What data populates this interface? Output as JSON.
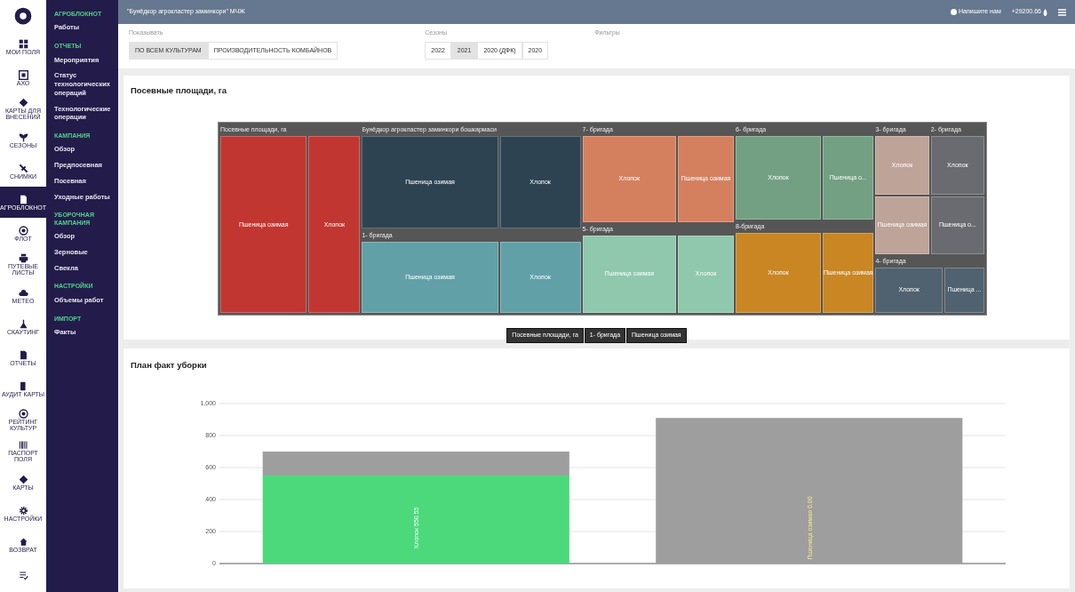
{
  "rail": [
    {
      "kind": "logo",
      "selected": false
    },
    {
      "kind": "grid",
      "label": "МОИ ПОЛЯ",
      "selected": false
    },
    {
      "kind": "qr",
      "label": "АХО",
      "selected": false
    },
    {
      "kind": "diamond",
      "label": "КАРТЫ ДЛЯ ВНЕСЕНИЙ",
      "selected": false
    },
    {
      "kind": "plant",
      "label": "СЕЗОНЫ",
      "selected": false
    },
    {
      "kind": "satellite",
      "label": "СНИМКИ",
      "selected": false
    },
    {
      "kind": "doc",
      "label": "АГРОБЛОКНОТ",
      "selected": true
    },
    {
      "kind": "wheel",
      "label": "ФЛОТ",
      "selected": false
    },
    {
      "kind": "printer",
      "label": "ПУТЕВЫЕ ЛИСТЫ",
      "selected": false
    },
    {
      "kind": "cloud",
      "label": "МЕТЕО",
      "selected": false
    },
    {
      "kind": "flask",
      "label": "СКАУТИНГ",
      "selected": false
    },
    {
      "kind": "doc",
      "label": "ОТЧЕТЫ",
      "selected": false
    },
    {
      "kind": "phone",
      "label": "АУДИТ КАРТЫ",
      "selected": false
    },
    {
      "kind": "wheel",
      "label": "РЕЙТИНГ КУЛЬТУР",
      "selected": false
    },
    {
      "kind": "barcode",
      "label": "ПАСПОРТ ПОЛЯ",
      "selected": false
    },
    {
      "kind": "diamond",
      "label": "КАРТЫ",
      "selected": false
    },
    {
      "kind": "gear",
      "label": "НАСТРОЙКИ",
      "selected": false
    },
    {
      "kind": "home",
      "label": "ВОЗВРАТ",
      "selected": false
    },
    {
      "kind": "list",
      "selected": false
    }
  ],
  "nav": [
    {
      "kind": "header",
      "label": "АГРОБЛОКНОТ"
    },
    {
      "kind": "item",
      "label": "Работы"
    },
    {
      "kind": "header",
      "label": "ОТЧЕТЫ"
    },
    {
      "kind": "item",
      "label": "Мероприятия"
    },
    {
      "kind": "item",
      "label": "Статус технологических операций"
    },
    {
      "kind": "item",
      "label": "Технологические операции"
    },
    {
      "kind": "header",
      "label": "КАМПАНИЯ"
    },
    {
      "kind": "item",
      "label": "Обзор"
    },
    {
      "kind": "item",
      "label": "Предпосевная"
    },
    {
      "kind": "item",
      "label": "Посевная"
    },
    {
      "kind": "item",
      "label": "Уходные работы"
    },
    {
      "kind": "header",
      "label": "УБОРОЧНАЯ КАМПАНИЯ"
    },
    {
      "kind": "item",
      "label": "Обзор"
    },
    {
      "kind": "item",
      "label": "Зерновые"
    },
    {
      "kind": "item",
      "label": "Свекла"
    },
    {
      "kind": "header",
      "label": "НАСТРОЙКИ"
    },
    {
      "kind": "item",
      "label": "Объемы работ"
    },
    {
      "kind": "header",
      "label": "ИМПОРТ"
    },
    {
      "kind": "item",
      "label": "Факты"
    }
  ],
  "topbar": {
    "title": "\"Бунёдкор агрокластер заминкори\" МЧЖ",
    "contact": "Напишите нам",
    "balance": "+29200.66"
  },
  "filters": {
    "show_label": "Показывать",
    "show_options": [
      {
        "label": "ПО ВСЕМ КУЛЬТУРАМ",
        "selected": true
      },
      {
        "label": "ПРОИЗВОДИТЕЛЬНОСТЬ КОМБАЙНОВ",
        "selected": false
      }
    ],
    "seasons_label": "Сезоны",
    "seasons": [
      {
        "label": "2022",
        "selected": false
      },
      {
        "label": "2021",
        "selected": true
      },
      {
        "label": "2020 (ДФК)",
        "selected": false
      },
      {
        "label": "2020",
        "selected": false
      }
    ],
    "filters_label": "Фильтры"
  },
  "treemap_card": {
    "title": "Посевные площади, га",
    "columns": [
      {
        "blocks": [
          {
            "groups": [
              {
                "name": "Посевные площади, га",
                "color": "#c13631",
                "leaves": [
                  "Пшеница озимая",
                  "Хлопок"
                ]
              }
            ]
          }
        ]
      },
      {
        "blocks": [
          {
            "groups": [
              {
                "name": "Бунёдкор агрокластер заминкори бошкармаси",
                "color": "#2e4352",
                "leaves": [
                  "Пшеница озимая",
                  "Хлопок"
                ]
              }
            ]
          },
          {
            "groups": [
              {
                "name": "1- бригада",
                "color": "#62a0a8",
                "leaves": [
                  "Пшеница озимая",
                  "Хлопок"
                ]
              }
            ]
          }
        ]
      },
      {
        "blocks": [
          {
            "groups": [
              {
                "name": "7- бригада",
                "color": "#d4805f",
                "leaves": [
                  "Хлопок",
                  "Пшеница озимая"
                ]
              }
            ]
          },
          {
            "groups": [
              {
                "name": "5- бригада",
                "color": "#8fc8ad",
                "leaves": [
                  "Пшеница озимая",
                  "Хлопок"
                ]
              }
            ]
          }
        ]
      },
      {
        "blocks": [
          {
            "groups": [
              {
                "name": "6- бригада",
                "color": "#73a083",
                "leaves": [
                  "Хлопок",
                  "Пшеница о..."
                ]
              }
            ]
          },
          {
            "groups": [
              {
                "name": "8-бригада",
                "color": "#c98623",
                "leaves": [
                  "Хлопок",
                  "Пшеница озимая"
                ]
              }
            ]
          }
        ]
      },
      {
        "blocks": [
          {
            "groups": [
              {
                "name": "3- бригада",
                "color": "#bea399",
                "leaves": [
                  "Хлопок",
                  "Пшеница озимая"
                ]
              },
              {
                "name": "2- бригада",
                "color": "#6a6b70",
                "leaves": [
                  "Хлопок",
                  "Пшеница о..."
                ]
              }
            ]
          },
          {
            "groups": [
              {
                "name": "4- бригада",
                "color": "#506270",
                "leaves": [
                  "Хлопок",
                  "Пшеница ..."
                ]
              }
            ]
          }
        ]
      }
    ],
    "breadcrumb": [
      "Посевные площади, га",
      "1- бригада",
      "Пшеница озимая"
    ]
  },
  "chart_card": {
    "title": "План факт уборки",
    "chart_data": {
      "type": "bar",
      "stacked": true,
      "orientation": "vertical",
      "grid": true,
      "ylim": [
        0,
        1000
      ],
      "yticks": [
        {
          "value": 0,
          "label": "0"
        },
        {
          "value": 200,
          "label": "200"
        },
        {
          "value": 400,
          "label": "400"
        },
        {
          "value": 600,
          "label": "600"
        },
        {
          "value": 800,
          "label": "800"
        },
        {
          "value": 1000,
          "label": "1,000"
        }
      ],
      "series": [
        {
          "color": "#4cd97b",
          "values": [
            550,
            0
          ]
        },
        {
          "color": "#9e9e9e",
          "values": [
            150,
            910
          ]
        }
      ],
      "value_labels": [
        {
          "label": "Хлопок 550.55",
          "color": "#ffffff"
        },
        {
          "label": "Пшеница озимая 0.00",
          "color": "#f3f08a"
        }
      ]
    }
  }
}
